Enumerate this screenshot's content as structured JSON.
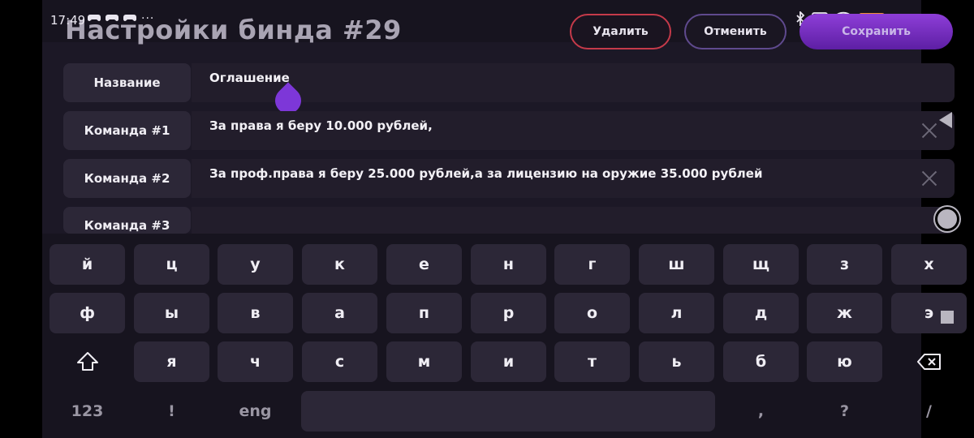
{
  "status_bar": {
    "time": "17:49",
    "left_icons": [
      "gamepad-icon",
      "gamepad-icon",
      "gamepad-icon",
      "more-icon"
    ],
    "right_icons": [
      "bluetooth-icon",
      "sim-x-icon",
      "wifi-icon",
      "battery-icon"
    ],
    "battery_level": "27"
  },
  "header": {
    "title": "Настройки бинда #29",
    "delete_label": "Удалить",
    "cancel_label": "Отменить",
    "save_label": "Сохранить"
  },
  "fields": [
    {
      "label": "Название",
      "value": "Оглашение"
    },
    {
      "label": "Команда #1",
      "value": "За права я беру 10.000 рублей,"
    },
    {
      "label": "Команда #2",
      "value": "За проф.права я беру 25.000 рублей,а за лицензию на оружие 35.000 рублей"
    },
    {
      "label": "Команда #3",
      "value": ""
    }
  ],
  "keyboard": {
    "row1": [
      "й",
      "ц",
      "у",
      "к",
      "е",
      "н",
      "г",
      "ш",
      "щ",
      "з",
      "х"
    ],
    "row2": [
      "ф",
      "ы",
      "в",
      "а",
      "п",
      "р",
      "о",
      "л",
      "д",
      "ж",
      "э"
    ],
    "row3": [
      "я",
      "ч",
      "с",
      "м",
      "и",
      "т",
      "ь",
      "б",
      "ю"
    ],
    "row4": {
      "numbers": "123",
      "exclaim": "!",
      "lang": "eng",
      "comma": ",",
      "question": "?",
      "slash": "/"
    },
    "shift_icon": "shift-icon",
    "backspace_icon": "backspace-icon"
  },
  "colors": {
    "accent": "#7d37d8",
    "delete_border": "#c53a4a",
    "cancel_border": "#5f4a8e",
    "battery": "#f09030"
  }
}
